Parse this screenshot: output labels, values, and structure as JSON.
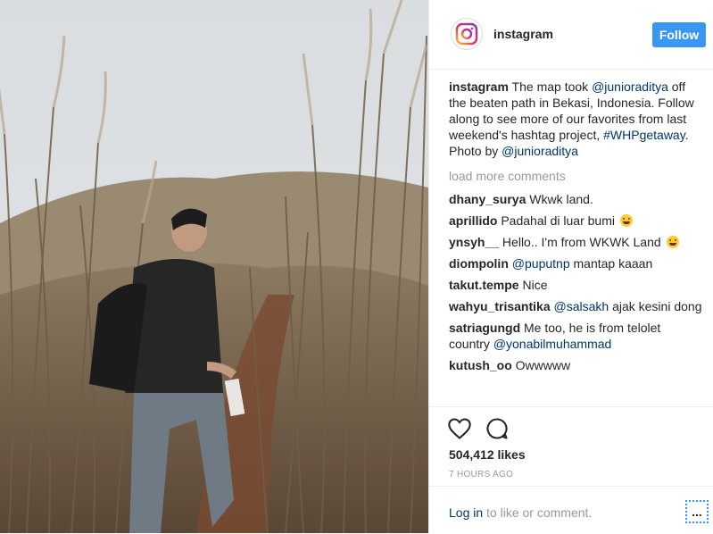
{
  "post": {
    "username": "instagram",
    "follow_label": "Follow",
    "caption": {
      "user": "instagram",
      "text_1": " The map took ",
      "mention_1": "@junioraditya",
      "text_2": " off the beaten path in Bekasi, Indonesia. Follow along to see more of our favorites from last weekend's hashtag project, ",
      "hashtag": "#WHPgetaway",
      "text_3": ".",
      "photo_by": "Photo by ",
      "mention_2": "@junioraditya"
    },
    "load_more": "load more comments",
    "comments": [
      {
        "user": "dhany_surya",
        "text": " Wkwk land."
      },
      {
        "user": "aprillido",
        "text": " Padahal di luar bumi "
      },
      {
        "user": "ynsyh__",
        "text": " Hello.. I'm from WKWK Land "
      },
      {
        "user": "diompolin",
        "mention": "@puputnp",
        "text": " mantap kaaan"
      },
      {
        "user": "takut.tempe",
        "text": " Nice"
      },
      {
        "user": "wahyu_trisantika",
        "mention": "@salsakh",
        "text": " ajak kesini dong"
      },
      {
        "user": "satriagungd",
        "text": " Me too, he is from telolet country ",
        "mention_after": "@yonabilmuhammad"
      },
      {
        "user": "kutush_oo",
        "text": " Owwwww"
      }
    ],
    "likes": "504,412 likes",
    "time_ago": "7 HOURS AGO",
    "login": {
      "link": "Log in",
      "text": " to like or comment."
    },
    "more_label": "..."
  },
  "colors": {
    "accent": "#3897f0",
    "link": "#003569",
    "muted": "#999999"
  },
  "icons": {
    "like": "heart-icon",
    "comment": "comment-icon",
    "more": "ellipsis-icon",
    "logo": "instagram-logo-icon"
  }
}
